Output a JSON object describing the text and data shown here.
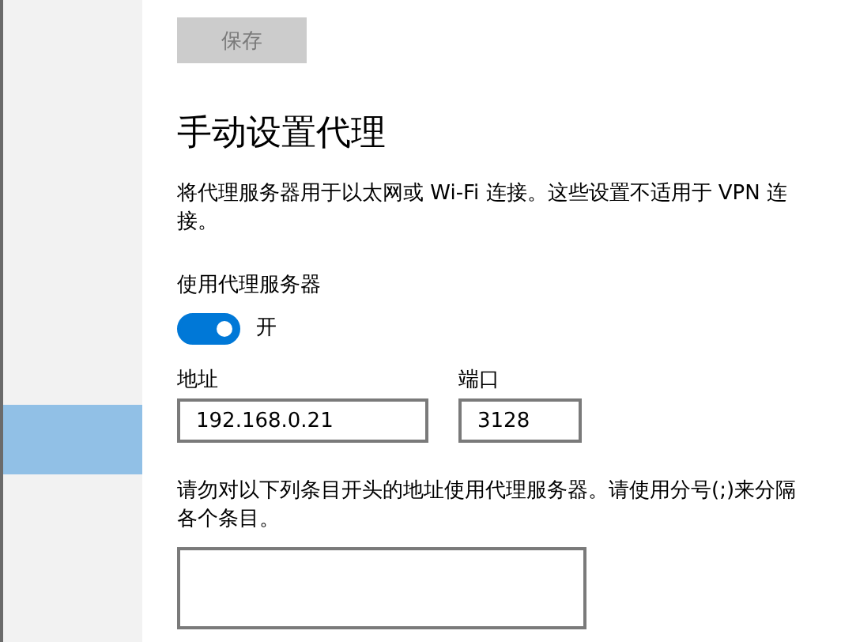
{
  "sidebar": {
    "highlighted_item": true
  },
  "save_button": {
    "label": "保存",
    "disabled": true
  },
  "heading": "手动设置代理",
  "description": "将代理服务器用于以太网或 Wi-Fi 连接。这些设置不适用于 VPN 连接。",
  "proxy_toggle": {
    "label": "使用代理服务器",
    "on": true,
    "state_text": "开"
  },
  "address": {
    "label": "地址",
    "value": "192.168.0.21"
  },
  "port": {
    "label": "端口",
    "value": "3128"
  },
  "exceptions": {
    "label": "请勿对以下列条目开头的地址使用代理服务器。请使用分号(;)来分隔各个条目。"
  }
}
